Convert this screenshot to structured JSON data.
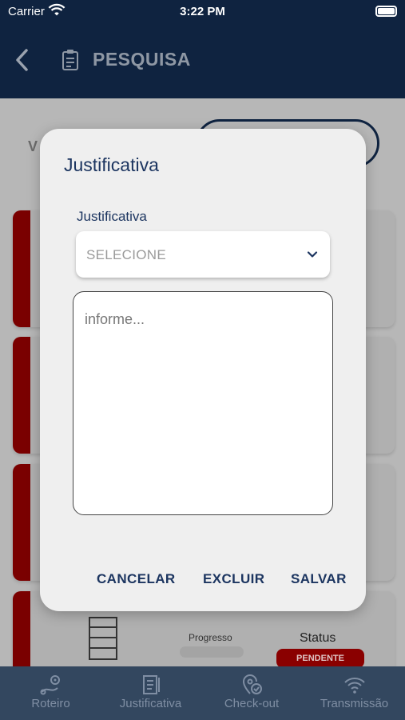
{
  "status_bar": {
    "carrier": "Carrier",
    "time": "3:22 PM"
  },
  "header": {
    "title": "PESQUISA"
  },
  "background": {
    "label_partial": "V",
    "progress_label": "Progresso",
    "status_label": "Status",
    "status_badge": "PENDENTE"
  },
  "modal": {
    "title": "Justificativa",
    "field_label": "Justificativa",
    "select_value": "SELECIONE",
    "textarea_placeholder": "informe...",
    "buttons": {
      "cancel": "CANCELAR",
      "delete": "EXCLUIR",
      "save": "SALVAR"
    }
  },
  "tabbar": {
    "items": [
      {
        "label": "Roteiro",
        "icon": "route-icon"
      },
      {
        "label": "Justificativa",
        "icon": "document-icon"
      },
      {
        "label": "Check-out",
        "icon": "checkout-icon"
      },
      {
        "label": "Transmissão",
        "icon": "wifi-icon"
      }
    ]
  },
  "colors": {
    "header_bg": "#0f2340",
    "accent_text": "#1c3560",
    "status_badge": "#8a0000"
  }
}
